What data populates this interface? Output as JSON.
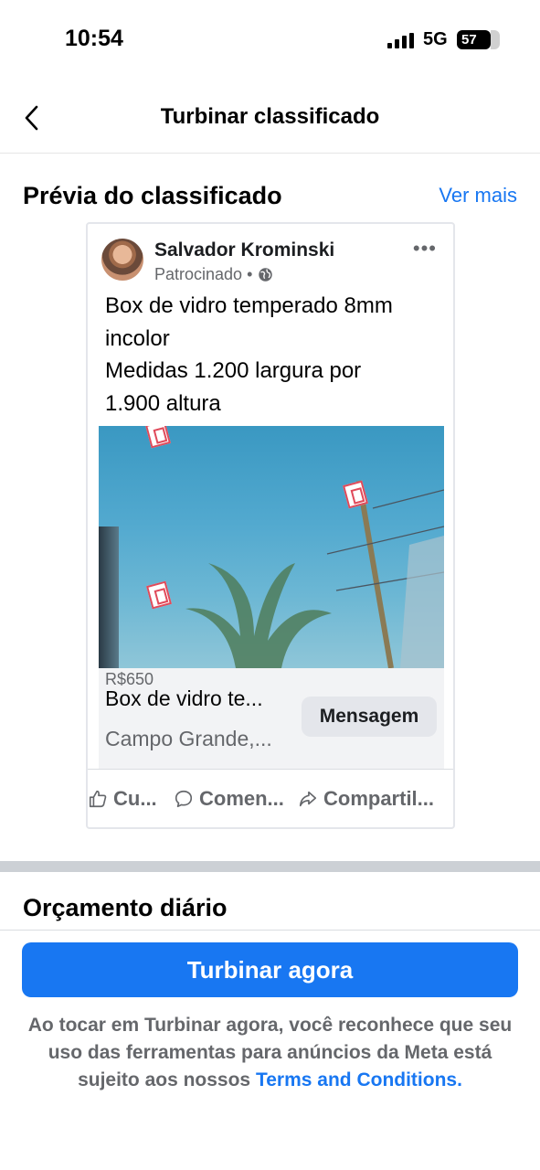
{
  "status_bar": {
    "time": "10:54",
    "network": "5G",
    "battery": "57"
  },
  "header": {
    "title": "Turbinar classificado",
    "back_icon": "chevron-left-icon"
  },
  "preview_section": {
    "title": "Prévia do classificado",
    "see_more": "Ver mais"
  },
  "post": {
    "author": "Salvador Krominski",
    "sponsored": "Patrocinado •",
    "text_lines": [
      "Box de vidro temperado 8mm",
      "incolor",
      "Medidas 1.200 largura por",
      "1.900 altura"
    ],
    "listing": {
      "price": "R$650",
      "title": "Box de vidro te...",
      "location": "Campo Grande,...",
      "message_button": "Mensagem"
    },
    "actions": {
      "like": "Cu...",
      "comment": "Comen...",
      "share": "Compartil..."
    }
  },
  "budget_section": {
    "title": "Orçamento diário"
  },
  "boost_button": "Turbinar agora",
  "disclaimer": {
    "text": "Ao tocar em Turbinar agora, você reconhece que seu uso das ferramentas para anúncios da Meta está sujeito aos nossos",
    "link": "Terms and Conditions."
  },
  "colors": {
    "accent": "#1877f2",
    "secondary_text": "#65676b"
  }
}
